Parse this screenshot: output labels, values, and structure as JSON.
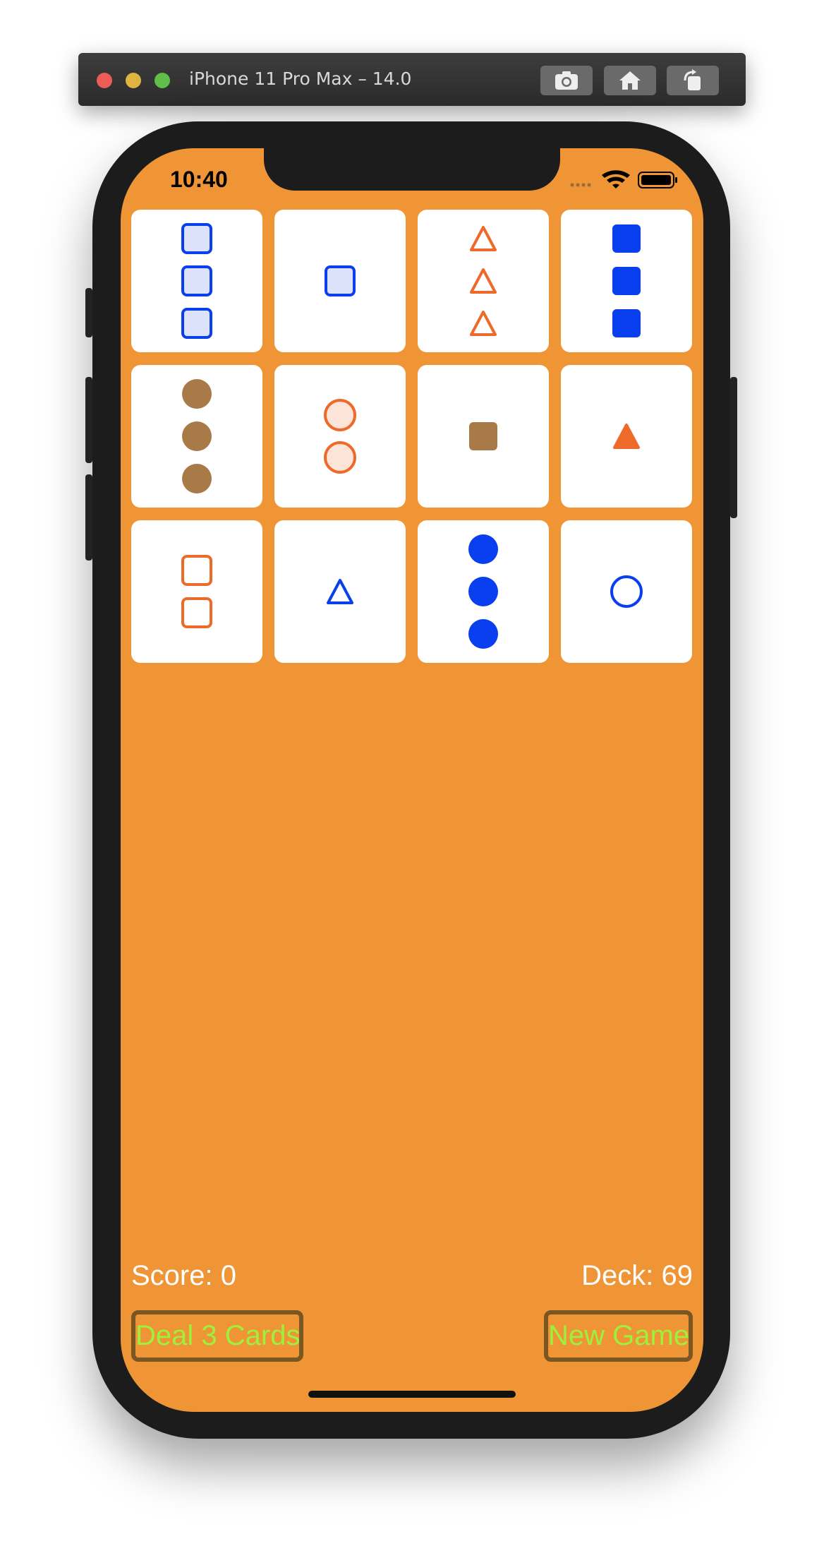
{
  "simulator": {
    "title": "iPhone 11 Pro Max – 14.0",
    "buttons": [
      "screenshot-icon",
      "home-icon",
      "rotate-icon"
    ]
  },
  "status_bar": {
    "time": "10:40"
  },
  "colors": {
    "background": "#f09535",
    "blue": "#0a3ff0",
    "orange": "#ee6a2a",
    "brown": "#a87a48",
    "button_text": "#9cf13d",
    "button_border": "#7a5623"
  },
  "cards": [
    {
      "count": 3,
      "shape": "square",
      "shading": "striped",
      "color": "blue"
    },
    {
      "count": 1,
      "shape": "square",
      "shading": "striped",
      "color": "blue"
    },
    {
      "count": 3,
      "shape": "triangle",
      "shading": "open",
      "color": "orange"
    },
    {
      "count": 3,
      "shape": "square",
      "shading": "solid",
      "color": "blue"
    },
    {
      "count": 3,
      "shape": "circle",
      "shading": "solid",
      "color": "brown"
    },
    {
      "count": 2,
      "shape": "circle",
      "shading": "striped",
      "color": "orange"
    },
    {
      "count": 1,
      "shape": "square",
      "shading": "solid",
      "color": "brown"
    },
    {
      "count": 1,
      "shape": "triangle",
      "shading": "solid",
      "color": "orange"
    },
    {
      "count": 2,
      "shape": "square",
      "shading": "open",
      "color": "orange"
    },
    {
      "count": 1,
      "shape": "triangle",
      "shading": "open",
      "color": "blue"
    },
    {
      "count": 3,
      "shape": "circle",
      "shading": "solid",
      "color": "blue"
    },
    {
      "count": 1,
      "shape": "circle",
      "shading": "open",
      "color": "blue"
    }
  ],
  "footer": {
    "score": "Score: 0",
    "deck": "Deck: 69",
    "deal_button": "Deal 3 Cards",
    "new_game_button": "New Game"
  }
}
